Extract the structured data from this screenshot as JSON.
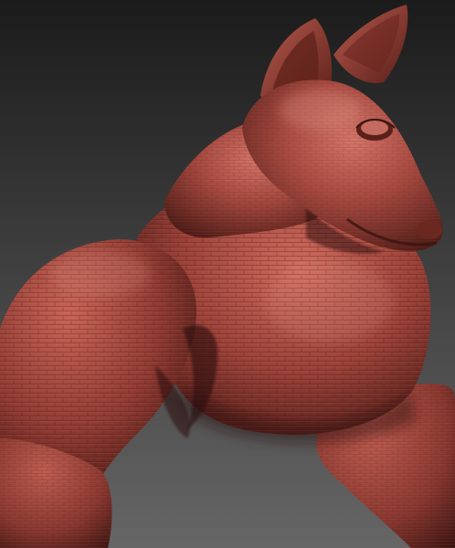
{
  "scene": {
    "subject": "sculpted-creature-model",
    "material": "clay-red",
    "colors": {
      "background_top": "#1b1b1b",
      "background_bottom": "#666666",
      "clay_base": "#8f3a32",
      "clay_light": "#cf6b5d",
      "clay_shadow": "#3a1410",
      "clay_highlight": "#e69a8c"
    }
  }
}
